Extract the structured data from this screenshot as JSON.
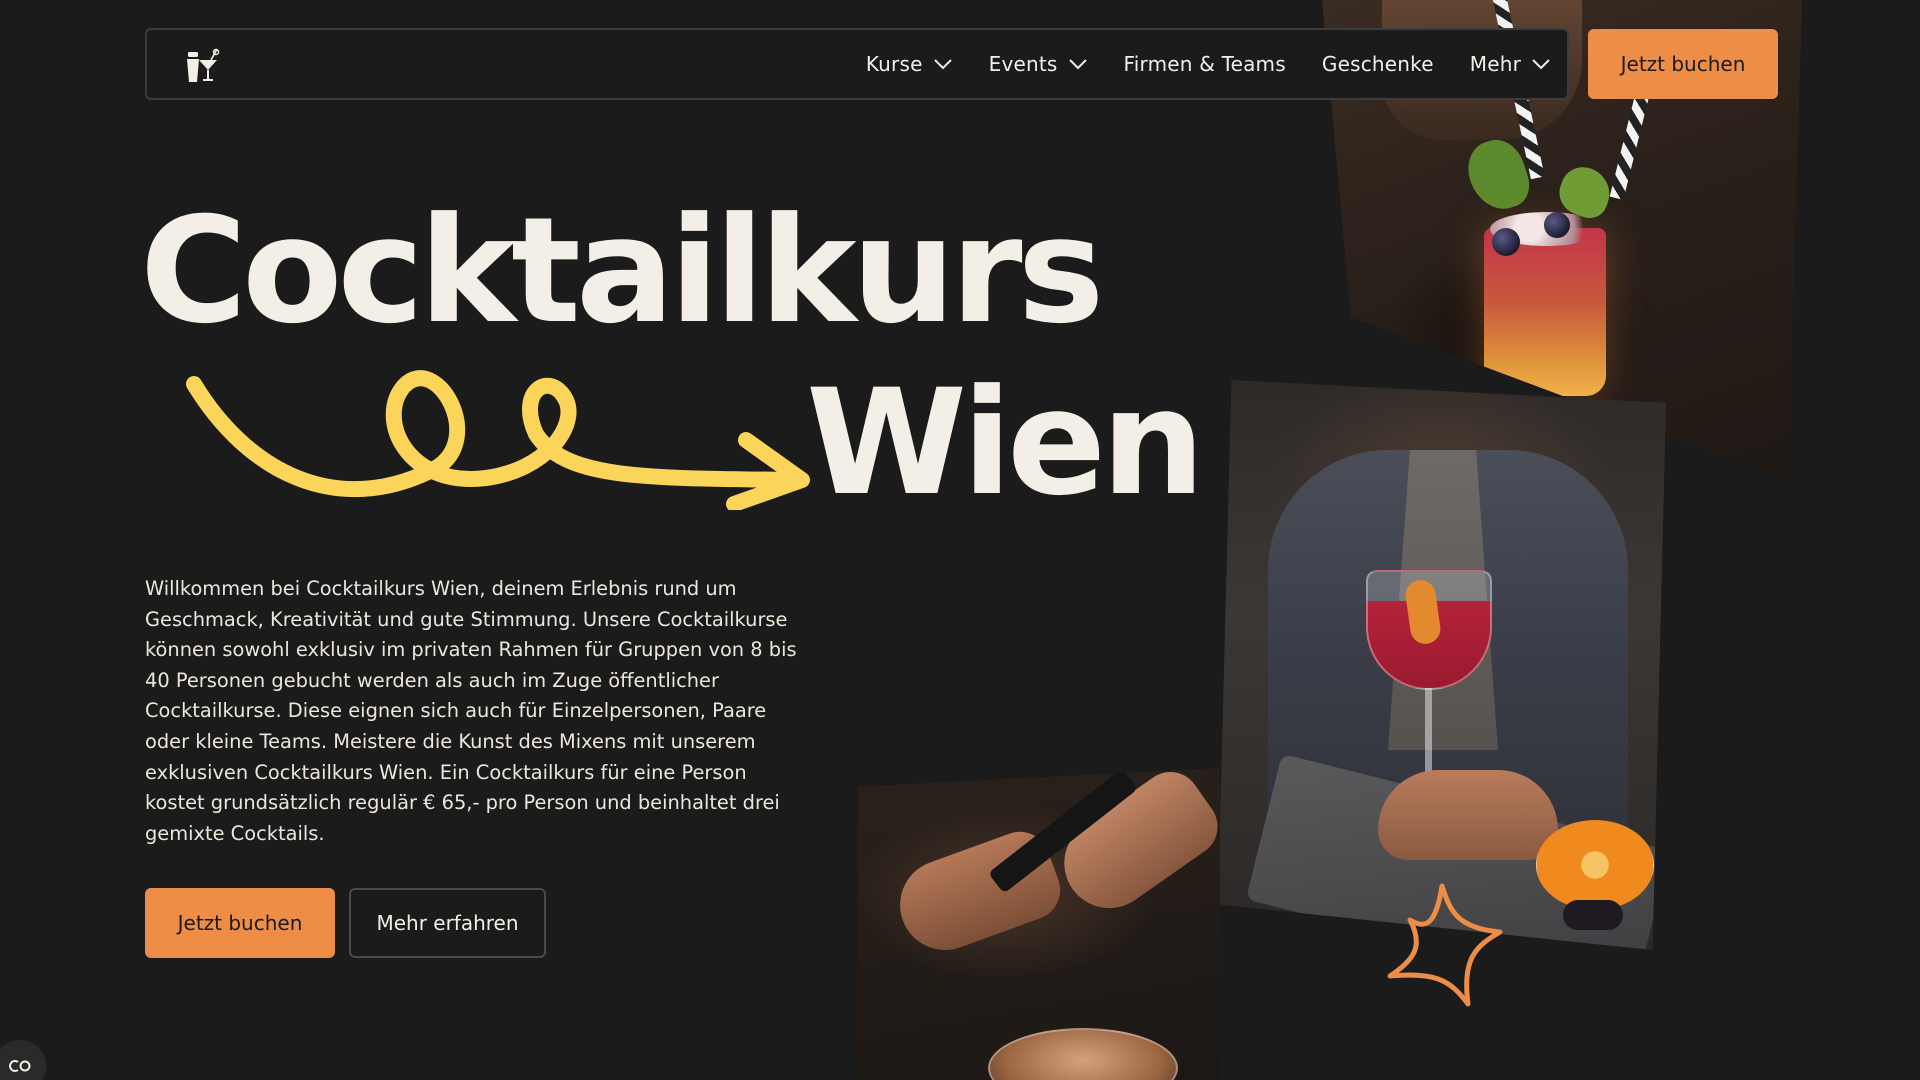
{
  "nav": {
    "items": [
      {
        "label": "Kurse",
        "dropdown": true
      },
      {
        "label": "Events",
        "dropdown": true
      },
      {
        "label": "Firmen & Teams",
        "dropdown": false
      },
      {
        "label": "Geschenke",
        "dropdown": false
      },
      {
        "label": "Mehr",
        "dropdown": true
      }
    ],
    "cta_label": "Jetzt buchen"
  },
  "hero": {
    "title_line1": "Cocktailkurs",
    "title_line2": "Wien",
    "intro": "Willkommen bei Cocktailkurs Wien, deinem Erlebnis rund um Geschmack, Kreativität und gute Stimmung. Unsere Cocktailkurse können sowohl exklusiv im privaten Rahmen für Gruppen von 8 bis 40 Personen gebucht werden als auch im Zuge öffentlicher Cocktailkurse. Diese eignen sich auch für Einzelpersonen, Paare oder kleine Teams. Meistere die Kunst des Mixens mit unserem exklusiven Cocktailkurs Wien. Ein Cocktailkurs für eine Person kostet grundsätzlich regulär € 65,- pro Person und beinhaltet drei gemixte Cocktails.",
    "primary_cta": "Jetzt buchen",
    "secondary_cta": "Mehr erfahren"
  },
  "colors": {
    "background": "#1b1b1b",
    "accent_orange": "#ee8d46",
    "squiggle_yellow": "#fbd45a",
    "text_light": "#f4efe6"
  },
  "icons": {
    "logo": "cocktail-shaker-glass-icon",
    "dropdown": "chevron-down-icon",
    "cookie": "cookie-settings-icon",
    "decoration": [
      "squiggle-arrow",
      "star-outline"
    ]
  }
}
